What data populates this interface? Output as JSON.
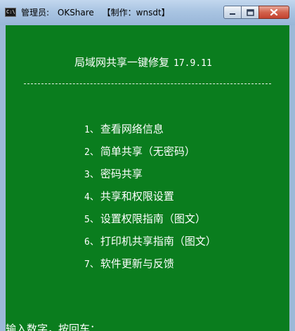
{
  "window": {
    "icon_text": "C:\\.",
    "title_role": "管理员:",
    "title_app": "OKShare",
    "title_credit": "【制作：wnsdt】"
  },
  "console": {
    "header_title": "局域网共享一键修复",
    "header_version": "17.9.11",
    "menu": [
      {
        "num": "1、",
        "label": "查看网络信息"
      },
      {
        "num": "2、",
        "label": "简单共享（无密码）"
      },
      {
        "num": "3、",
        "label": "密码共享"
      },
      {
        "num": "4、",
        "label": "共享和权限设置"
      },
      {
        "num": "5、",
        "label": "设置权限指南（图文）"
      },
      {
        "num": "6、",
        "label": "打印机共享指南（图文）"
      },
      {
        "num": "7、",
        "label": "软件更新与反馈"
      }
    ],
    "prompt": "输入数字，按回车："
  },
  "colors": {
    "console_bg": "#0a7d1e",
    "console_fg": "#ffffff",
    "titlebar": "#a9c4e2",
    "close_button": "#c44230"
  }
}
